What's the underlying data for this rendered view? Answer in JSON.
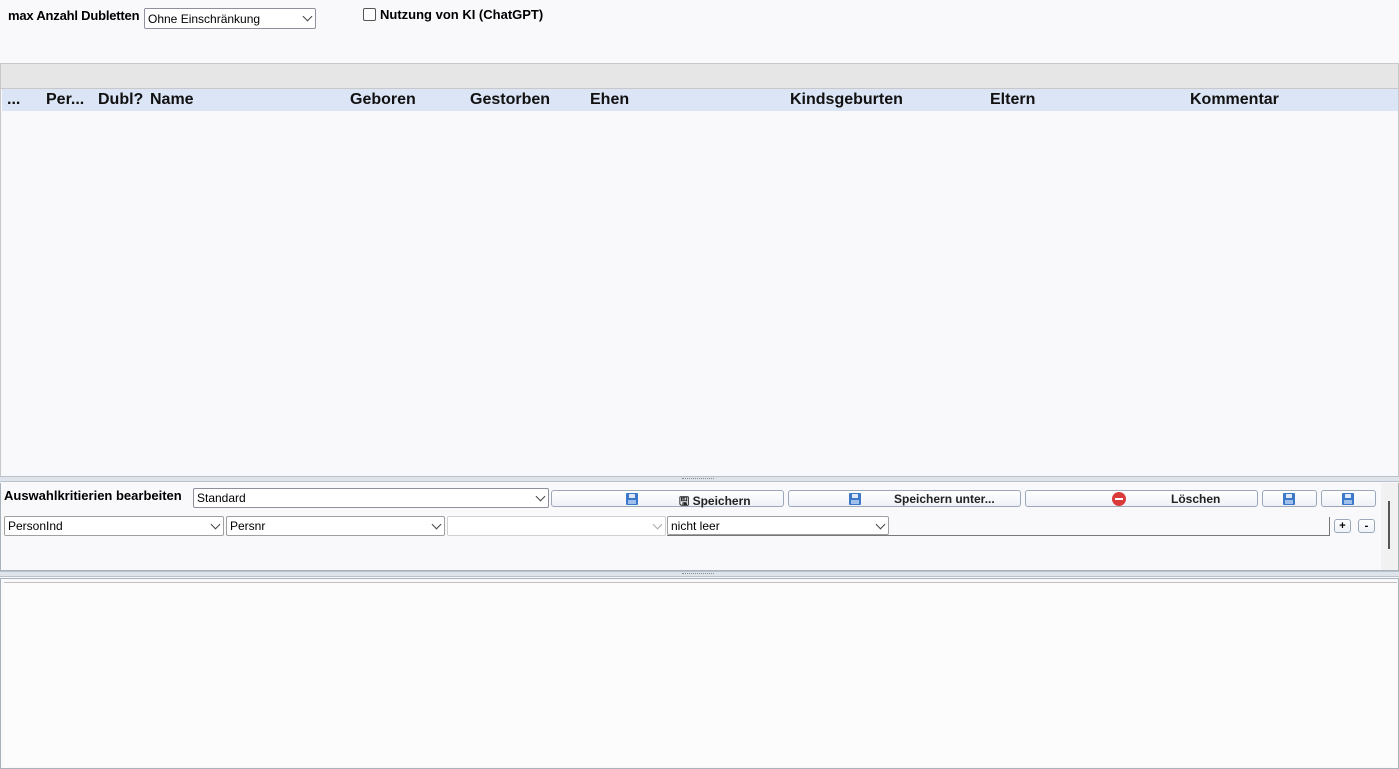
{
  "top": {
    "max_label": "max Anzahl Dubletten",
    "max_select_value": "Ohne Einschränkung",
    "ki_label": "Nutzung von KI (ChatGPT)"
  },
  "grid": {
    "columns": [
      "...",
      "Per...",
      "Dubl?",
      "Name",
      "Geboren",
      "Gestorben",
      "Ehen",
      "Kindsgeburten",
      "Eltern",
      "Kommentar"
    ]
  },
  "criteria": {
    "label": "Auswahlkritierien bearbeiten",
    "profile_value": "Standard",
    "save_label": "Speichern",
    "save_as_label": "Speichern unter...",
    "delete_label": "Löschen",
    "row": {
      "field1": "PersonInd",
      "field2": "Persnr",
      "field3": "",
      "condition": "nicht leer",
      "plus": "+",
      "minus": "-"
    }
  },
  "icons": {
    "save": "floppy-disk-icon",
    "save_as": "floppy-disk-list-icon",
    "delete": "no-entry-icon"
  }
}
